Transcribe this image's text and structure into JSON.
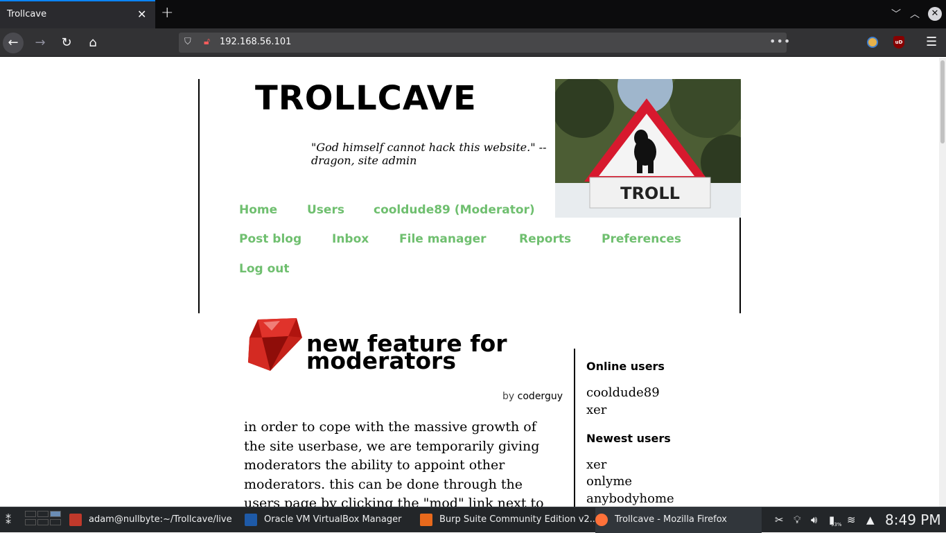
{
  "browser": {
    "tab_title": "Trollcave",
    "url": "192.168.56.101",
    "more_label": "•••"
  },
  "site": {
    "title": "TROLLCAVE",
    "tagline": "\"God himself cannot hack this website.\" -- dragon, site admin",
    "troll_sign_text": "TROLL",
    "nav": [
      {
        "label": "Home"
      },
      {
        "label": "Users"
      },
      {
        "label": "cooldude89 (Moderator)"
      },
      {
        "label": "Post blog"
      },
      {
        "label": "Inbox"
      },
      {
        "label": "File manager"
      },
      {
        "label": "Reports"
      },
      {
        "label": "Preferences"
      },
      {
        "label": "Log out"
      }
    ]
  },
  "post": {
    "title": "new feature for moderators",
    "by_label": "by",
    "author": "coderguy",
    "body": "in order to cope with the massive growth of the site userbase, we are temporarily giving moderators the ability to appoint other moderators. this can be done through the users page by clicking the \"mod\" link next to"
  },
  "sidebar": {
    "online_heading": "Online users",
    "online_users": [
      "cooldude89",
      "xer"
    ],
    "newest_heading": "Newest users",
    "newest_users": [
      "xer",
      "onlyme",
      "anybodyhome"
    ]
  },
  "taskbar": {
    "tasks": [
      {
        "label": "adam@nullbyte:~/Trollcave/live",
        "color": "#c0392b"
      },
      {
        "label": "Oracle VM VirtualBox Manager",
        "color": "#1e5aa8"
      },
      {
        "label": "Burp Suite Community Edition v2...",
        "color": "#e8691c"
      },
      {
        "label": "Trollcave - Mozilla Firefox",
        "color": "#ff7139"
      }
    ],
    "battery_percent": "93%",
    "clock": "8:49 PM"
  },
  "colors": {
    "nav_link": "#6fbf6f",
    "chrome_dark": "#0c0c0d",
    "tab_accent": "#0a84ff",
    "taskbar": "#232629"
  }
}
